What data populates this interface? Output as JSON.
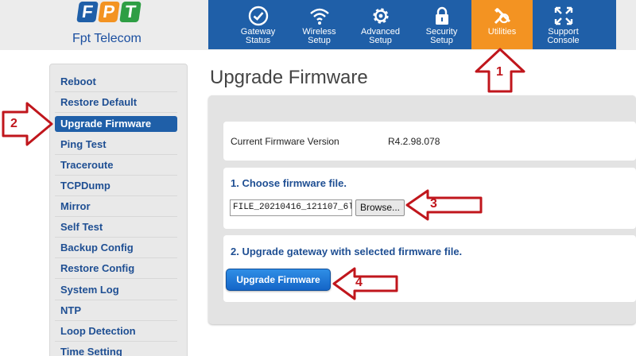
{
  "brand": {
    "letters": [
      "F",
      "P",
      "T"
    ],
    "letter_colors": [
      "#1f5fa8",
      "#f39322",
      "#2e9e44"
    ],
    "name": "Fpt Telecom"
  },
  "nav": [
    {
      "label": "Gateway\nStatus",
      "icon": "check-circle-icon",
      "active": false
    },
    {
      "label": "Wireless\nSetup",
      "icon": "wifi-icon",
      "active": false
    },
    {
      "label": "Advanced\nSetup",
      "icon": "gear-icon",
      "active": false
    },
    {
      "label": "Security\nSetup",
      "icon": "lock-icon",
      "active": false
    },
    {
      "label": "Utilities",
      "icon": "tools-icon",
      "active": true
    },
    {
      "label": "Support\nConsole",
      "icon": "arrows-icon",
      "active": false
    }
  ],
  "sidebar": {
    "items": [
      {
        "label": "Reboot"
      },
      {
        "label": "Restore Default"
      },
      {
        "label": "Upgrade Firmware",
        "active": true
      },
      {
        "label": "Ping Test"
      },
      {
        "label": "Traceroute"
      },
      {
        "label": "TCPDump"
      },
      {
        "label": "Mirror"
      },
      {
        "label": "Self Test"
      },
      {
        "label": "Backup Config"
      },
      {
        "label": "Restore Config"
      },
      {
        "label": "System Log"
      },
      {
        "label": "NTP"
      },
      {
        "label": "Loop Detection"
      },
      {
        "label": "Time Setting"
      }
    ]
  },
  "main": {
    "title": "Upgrade Firmware",
    "current_fw_label": "Current Firmware Version",
    "current_fw_value": "R4.2.98.078",
    "step1_title": "1. Choose firmware file.",
    "file_value": "FILE_20210416_121107_6l",
    "browse_label": "Browse...",
    "step2_title": "2. Upgrade gateway with selected firmware file.",
    "upgrade_label": "Upgrade Firmware"
  },
  "annotations": [
    "1",
    "2",
    "3",
    "4"
  ],
  "colors": {
    "nav_blue": "#1f5fa8",
    "active_orange": "#f39322",
    "link_blue": "#1f4f93",
    "annotation_red": "#c0161c"
  }
}
